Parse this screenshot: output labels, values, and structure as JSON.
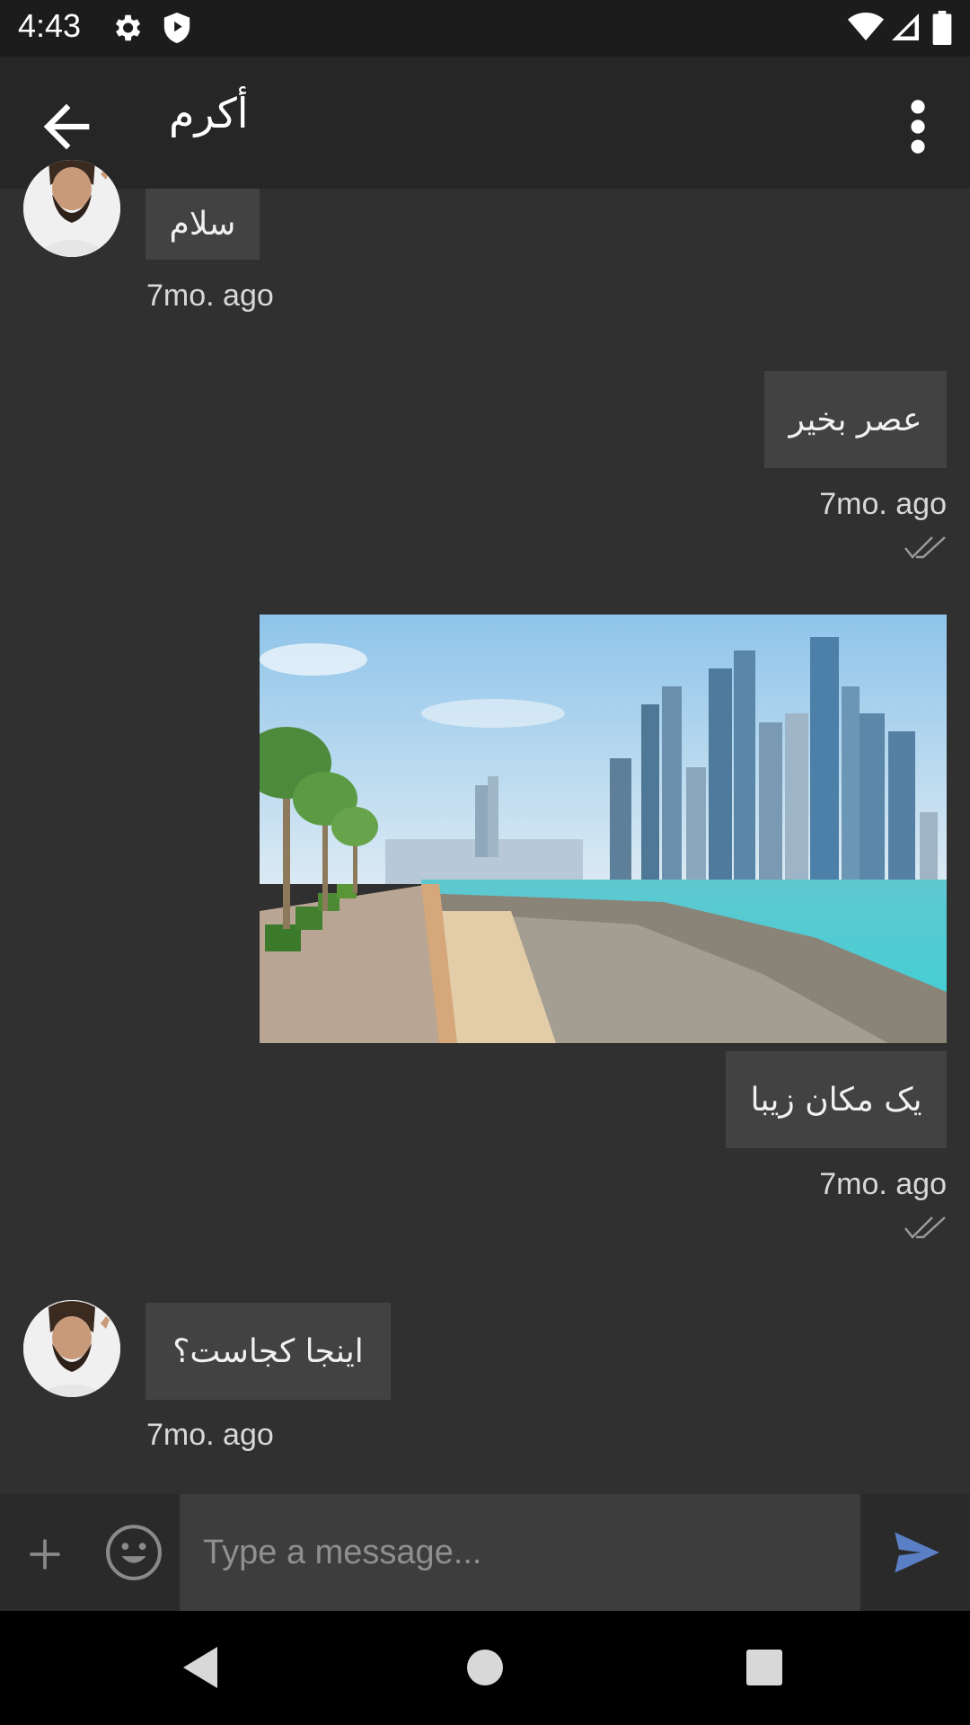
{
  "status": {
    "time": "4:43",
    "icons": [
      "gear-icon",
      "shield-icon",
      "wifi-icon",
      "signal-icon",
      "battery-icon"
    ]
  },
  "toolbar": {
    "title": "أكرم",
    "back_icon": "arrow-back-icon",
    "menu_icon": "more-vert-icon"
  },
  "messages": [
    {
      "side": "incoming",
      "text": "سلام",
      "time": "7mo. ago"
    },
    {
      "side": "outgoing",
      "text": "عصر بخیر",
      "time": "7mo. ago",
      "status": "double-check-icon"
    },
    {
      "side": "outgoing",
      "type": "image",
      "image": "city-waterfront-photo"
    },
    {
      "side": "outgoing",
      "text": "یک مکان زیبا",
      "time": "7mo. ago",
      "status": "double-check-icon"
    },
    {
      "side": "incoming",
      "text": "اینجا کجاست؟",
      "time": "7mo. ago"
    }
  ],
  "composer": {
    "placeholder": "Type a message...",
    "add_icon": "plus-icon",
    "emoji_icon": "emoji-icon",
    "send_icon": "send-icon"
  },
  "colors": {
    "background": "#303030",
    "bubble": "#424242",
    "send": "#5a7fc4"
  }
}
